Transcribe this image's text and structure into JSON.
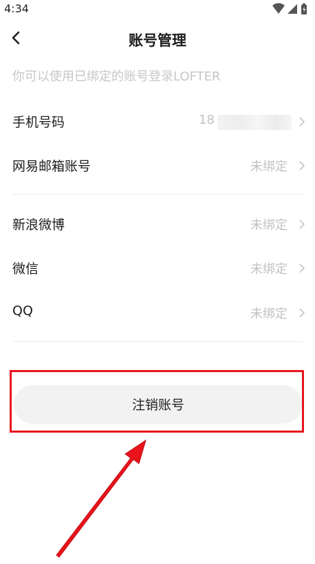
{
  "status_bar": {
    "time": "4:34"
  },
  "header": {
    "title": "账号管理"
  },
  "hint": "你可以使用已绑定的账号登录LOFTER",
  "accounts": [
    {
      "label": "手机号码",
      "value": "18"
    },
    {
      "label": "网易邮箱账号",
      "value": "未绑定"
    },
    {
      "label": "新浪微博",
      "value": "未绑定"
    },
    {
      "label": "微信",
      "value": "未绑定"
    },
    {
      "label": "QQ",
      "value": "未绑定"
    }
  ],
  "cancel_button": {
    "label": "注销账号"
  },
  "colors": {
    "highlight": "#e8131b",
    "placeholder_text": "#c2c2c2",
    "button_bg": "#f2f2f2"
  },
  "icons": [
    "wifi-icon",
    "signal-icon",
    "battery-icon",
    "back-arrow-icon",
    "chevron-right-icon",
    "red-arrow-annotation-icon"
  ]
}
